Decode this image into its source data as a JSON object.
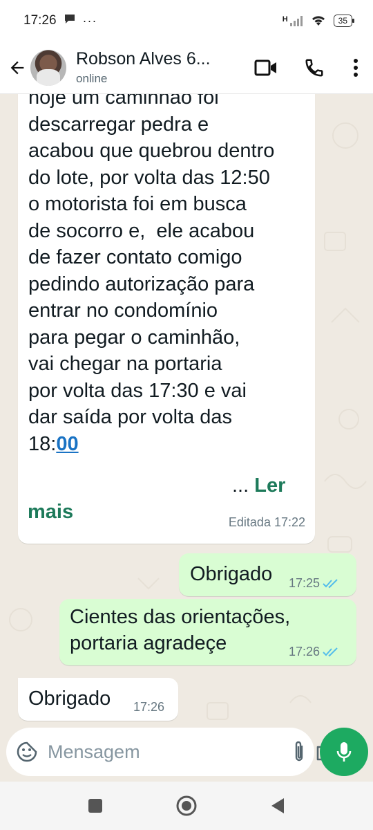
{
  "status_bar": {
    "time": "17:26",
    "more": "···",
    "battery": "35",
    "network_label": "H"
  },
  "header": {
    "contact_name": "Robson Alves 6...",
    "contact_status": "online"
  },
  "messages": {
    "long_message": {
      "text": "hoje um caminhão foi\ndescarregar pedra e\nacabou que quebrou dentro\ndo lote, por volta das 12:50\no motorista foi em busca\nde socorro e,  ele acabou\nde fazer contato comigo\npedindo autorização para\nentrar no condomínio\npara pegar o caminhão,\nvai chegar na portaria\npor volta das 17:30 e vai\ndar saída por volta das\n18:",
      "link_text": "00",
      "ellipsis": "...",
      "read_more_1": "Ler",
      "read_more_2": "mais",
      "edited_label": "Editada 17:22"
    },
    "out_1": {
      "text": "Obrigado",
      "time": "17:25"
    },
    "out_2": {
      "line1": "Cientes das orientações,",
      "line2": "portaria agradeçe",
      "time": "17:26"
    },
    "in_1": {
      "text": "Obrigado",
      "time": "17:26"
    }
  },
  "input": {
    "placeholder": "Mensagem",
    "value": ""
  },
  "colors": {
    "accent": "#00a884",
    "mic_button": "#1daa61",
    "outgoing_bubble": "#d9fdd3",
    "incoming_bubble": "#ffffff",
    "chat_background": "#efeae2",
    "read_ticks": "#53bdeb",
    "read_more": "#1d7a5a",
    "link": "#1a73c4"
  },
  "icons": {
    "back": "arrow-left-icon",
    "video": "video-call-icon",
    "call": "phone-icon",
    "menu": "more-vert-icon",
    "emoji": "sticker-icon",
    "attach": "paperclip-icon",
    "camera": "camera-icon",
    "mic": "mic-icon",
    "read": "double-check-icon"
  }
}
